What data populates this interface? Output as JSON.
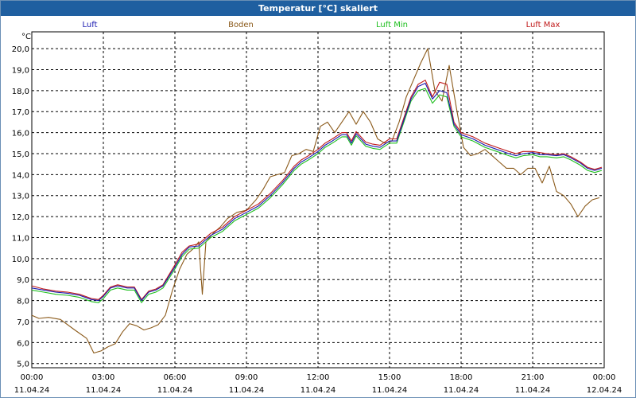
{
  "window": {
    "title": "Temperatur [°C] skaliert"
  },
  "chart_data": {
    "type": "line",
    "title": "Temperatur [°C] skaliert",
    "ylabel": "°C",
    "xlabel": "",
    "ylim": [
      4.8,
      20.8
    ],
    "xlim": [
      0,
      24
    ],
    "grid": true,
    "legend_position": "top",
    "y_ticks": [
      "5,0",
      "6,0",
      "7,0",
      "8,0",
      "9,0",
      "10,0",
      "11,0",
      "12,0",
      "13,0",
      "14,0",
      "15,0",
      "16,0",
      "17,0",
      "18,0",
      "19,0",
      "20,0"
    ],
    "x_ticks": [
      {
        "time": "00:00",
        "date": "11.04.24"
      },
      {
        "time": "03:00",
        "date": "11.04.24"
      },
      {
        "time": "06:00",
        "date": "11.04.24"
      },
      {
        "time": "09:00",
        "date": "11.04.24"
      },
      {
        "time": "12:00",
        "date": "11.04.24"
      },
      {
        "time": "15:00",
        "date": "11.04.24"
      },
      {
        "time": "18:00",
        "date": "11.04.24"
      },
      {
        "time": "21:00",
        "date": "11.04.24"
      },
      {
        "time": "00:00",
        "date": "12.04.24"
      }
    ],
    "series": [
      {
        "name": "Luft",
        "color": "#1a1ab0",
        "x": [
          0,
          0.5,
          1,
          1.5,
          2,
          2.5,
          2.8,
          3,
          3.3,
          3.6,
          4,
          4.3,
          4.6,
          4.9,
          5.2,
          5.5,
          6,
          6.3,
          6.6,
          7,
          7.5,
          8,
          8.5,
          9,
          9.5,
          10,
          10.5,
          11,
          11.3,
          11.6,
          12,
          12.3,
          12.6,
          13,
          13.2,
          13.4,
          13.6,
          13.8,
          14,
          14.3,
          14.6,
          15,
          15.3,
          15.6,
          15.9,
          16.2,
          16.5,
          16.8,
          17.1,
          17.4,
          17.7,
          18,
          18.5,
          19,
          19.5,
          20,
          20.3,
          20.6,
          21,
          21.3,
          21.6,
          22,
          22.3,
          22.6,
          23,
          23.3,
          23.6,
          23.9
        ],
        "values": [
          8.6,
          8.5,
          8.4,
          8.35,
          8.25,
          8.05,
          8.0,
          8.2,
          8.6,
          8.7,
          8.6,
          8.6,
          8.0,
          8.4,
          8.5,
          8.7,
          9.6,
          10.2,
          10.55,
          10.6,
          11.1,
          11.4,
          11.9,
          12.2,
          12.5,
          13.0,
          13.6,
          14.3,
          14.6,
          14.8,
          15.1,
          15.4,
          15.6,
          15.9,
          15.9,
          15.5,
          15.95,
          15.7,
          15.45,
          15.35,
          15.3,
          15.6,
          15.6,
          16.6,
          17.6,
          18.2,
          18.35,
          17.6,
          18.0,
          17.9,
          16.4,
          15.9,
          15.7,
          15.4,
          15.2,
          15.0,
          14.9,
          15.0,
          15.05,
          14.95,
          14.95,
          14.9,
          14.95,
          14.8,
          14.55,
          14.3,
          14.2,
          14.3
        ]
      },
      {
        "name": "Boden",
        "color": "#8b5a1a",
        "x": [
          0,
          0.3,
          0.7,
          1.2,
          1.8,
          2.3,
          2.6,
          2.9,
          3.2,
          3.5,
          3.8,
          4.1,
          4.4,
          4.7,
          5.0,
          5.3,
          5.6,
          5.9,
          6.2,
          6.5,
          6.8,
          7.0,
          7.15,
          7.3,
          7.6,
          7.9,
          8.2,
          8.6,
          9.0,
          9.4,
          9.7,
          10.0,
          10.3,
          10.6,
          10.9,
          11.2,
          11.5,
          11.8,
          12.1,
          12.4,
          12.7,
          13.0,
          13.3,
          13.6,
          13.9,
          14.2,
          14.5,
          14.8,
          15.1,
          15.4,
          15.7,
          16.0,
          16.3,
          16.6,
          16.9,
          17.2,
          17.5,
          17.8,
          18.1,
          18.4,
          18.7,
          19.0,
          19.3,
          19.6,
          19.9,
          20.2,
          20.5,
          20.8,
          21.1,
          21.4,
          21.7,
          22.0,
          22.3,
          22.6,
          22.9,
          23.2,
          23.5,
          23.8
        ],
        "values": [
          7.3,
          7.15,
          7.2,
          7.1,
          6.6,
          6.2,
          5.5,
          5.6,
          5.8,
          5.95,
          6.5,
          6.9,
          6.8,
          6.6,
          6.7,
          6.85,
          7.3,
          8.5,
          9.5,
          10.2,
          10.5,
          10.8,
          8.3,
          10.8,
          11.2,
          11.5,
          11.9,
          12.2,
          12.3,
          12.8,
          13.3,
          13.9,
          14.0,
          14.1,
          14.9,
          15.0,
          15.2,
          15.1,
          16.3,
          16.5,
          16.0,
          16.5,
          17.0,
          16.4,
          17.0,
          16.5,
          15.7,
          15.5,
          15.6,
          16.5,
          17.7,
          18.5,
          19.3,
          20.0,
          18.0,
          17.5,
          19.2,
          17.2,
          15.3,
          14.9,
          15.0,
          15.2,
          14.9,
          14.6,
          14.3,
          14.3,
          14.0,
          14.3,
          14.3,
          13.6,
          14.4,
          13.2,
          13.0,
          12.6,
          12.0,
          12.5,
          12.8,
          12.9
        ]
      },
      {
        "name": "Luft Min",
        "color": "#1fbf1f",
        "x": [
          0,
          0.5,
          1,
          1.5,
          2,
          2.5,
          2.8,
          3,
          3.3,
          3.6,
          4,
          4.3,
          4.6,
          4.9,
          5.2,
          5.5,
          6,
          6.3,
          6.6,
          7,
          7.5,
          8,
          8.5,
          9,
          9.5,
          10,
          10.5,
          11,
          11.3,
          11.6,
          12,
          12.3,
          12.6,
          13,
          13.2,
          13.4,
          13.6,
          13.8,
          14,
          14.3,
          14.6,
          15,
          15.3,
          15.6,
          15.9,
          16.2,
          16.5,
          16.8,
          17.1,
          17.4,
          17.7,
          18,
          18.5,
          19,
          19.5,
          20,
          20.3,
          20.6,
          21,
          21.3,
          21.6,
          22,
          22.3,
          22.6,
          23,
          23.3,
          23.6,
          23.9
        ],
        "values": [
          8.5,
          8.4,
          8.3,
          8.25,
          8.15,
          7.95,
          7.9,
          8.1,
          8.5,
          8.6,
          8.5,
          8.5,
          7.9,
          8.3,
          8.4,
          8.6,
          9.5,
          10.1,
          10.45,
          10.5,
          11.0,
          11.3,
          11.8,
          12.1,
          12.4,
          12.9,
          13.5,
          14.2,
          14.5,
          14.7,
          15.0,
          15.3,
          15.5,
          15.8,
          15.8,
          15.4,
          15.85,
          15.6,
          15.35,
          15.25,
          15.2,
          15.5,
          15.5,
          16.5,
          17.5,
          18.0,
          18.1,
          17.4,
          17.8,
          17.7,
          16.3,
          15.8,
          15.6,
          15.3,
          15.1,
          14.9,
          14.8,
          14.9,
          14.95,
          14.85,
          14.85,
          14.8,
          14.85,
          14.7,
          14.45,
          14.2,
          14.1,
          14.2
        ]
      },
      {
        "name": "Luft Max",
        "color": "#c01a1a",
        "x": [
          0,
          0.5,
          1,
          1.5,
          2,
          2.5,
          2.8,
          3,
          3.3,
          3.6,
          4,
          4.3,
          4.6,
          4.9,
          5.2,
          5.5,
          6,
          6.3,
          6.6,
          7,
          7.5,
          8,
          8.5,
          9,
          9.5,
          10,
          10.5,
          11,
          11.3,
          11.6,
          12,
          12.3,
          12.6,
          13,
          13.2,
          13.4,
          13.6,
          13.8,
          14,
          14.3,
          14.6,
          15,
          15.3,
          15.6,
          15.9,
          16.2,
          16.5,
          16.8,
          17.1,
          17.4,
          17.7,
          18,
          18.5,
          19,
          19.5,
          20,
          20.3,
          20.6,
          21,
          21.3,
          21.6,
          22,
          22.3,
          22.6,
          23,
          23.3,
          23.6,
          23.9
        ],
        "values": [
          8.7,
          8.55,
          8.45,
          8.4,
          8.3,
          8.1,
          8.05,
          8.25,
          8.65,
          8.75,
          8.65,
          8.65,
          8.05,
          8.45,
          8.55,
          8.75,
          9.7,
          10.3,
          10.6,
          10.7,
          11.2,
          11.5,
          12.0,
          12.3,
          12.6,
          13.1,
          13.7,
          14.4,
          14.7,
          14.9,
          15.2,
          15.5,
          15.7,
          16.0,
          16.0,
          15.6,
          16.05,
          15.8,
          15.55,
          15.45,
          15.4,
          15.7,
          15.7,
          16.7,
          17.7,
          18.3,
          18.5,
          17.7,
          18.4,
          18.3,
          16.5,
          16.0,
          15.8,
          15.5,
          15.3,
          15.1,
          15.0,
          15.1,
          15.1,
          15.05,
          15.0,
          14.95,
          15.0,
          14.85,
          14.6,
          14.35,
          14.25,
          14.35
        ]
      }
    ]
  }
}
